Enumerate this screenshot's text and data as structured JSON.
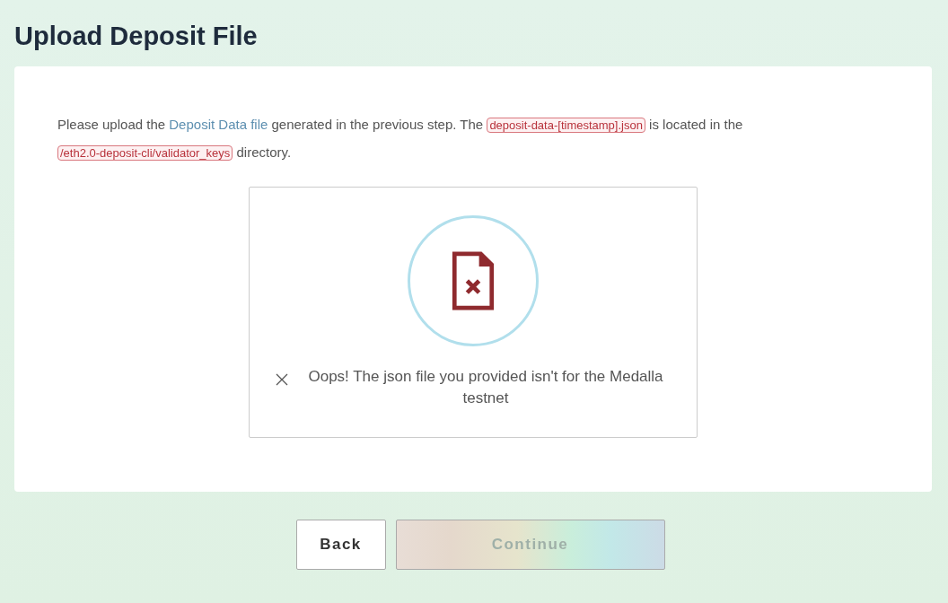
{
  "title": "Upload Deposit File",
  "intro": [
    {
      "kind": "text",
      "text": "Please upload the "
    },
    {
      "kind": "link",
      "text": "Deposit Data file"
    },
    {
      "kind": "text",
      "text": " generated in the previous step. The "
    },
    {
      "kind": "code",
      "text": "deposit-data-[timestamp].json"
    },
    {
      "kind": "text",
      "text": " is located in the "
    },
    {
      "kind": "code",
      "text": "/eth2.0-deposit-cli/validator_keys"
    },
    {
      "kind": "text",
      "text": " directory."
    }
  ],
  "dropzone": {
    "error": true,
    "message": "Oops! The json file you provided isn't for the Medalla testnet"
  },
  "buttons": [
    {
      "kind": "back",
      "label": "Back",
      "disabled": false
    },
    {
      "kind": "continue",
      "label": "Continue",
      "disabled": true
    }
  ]
}
